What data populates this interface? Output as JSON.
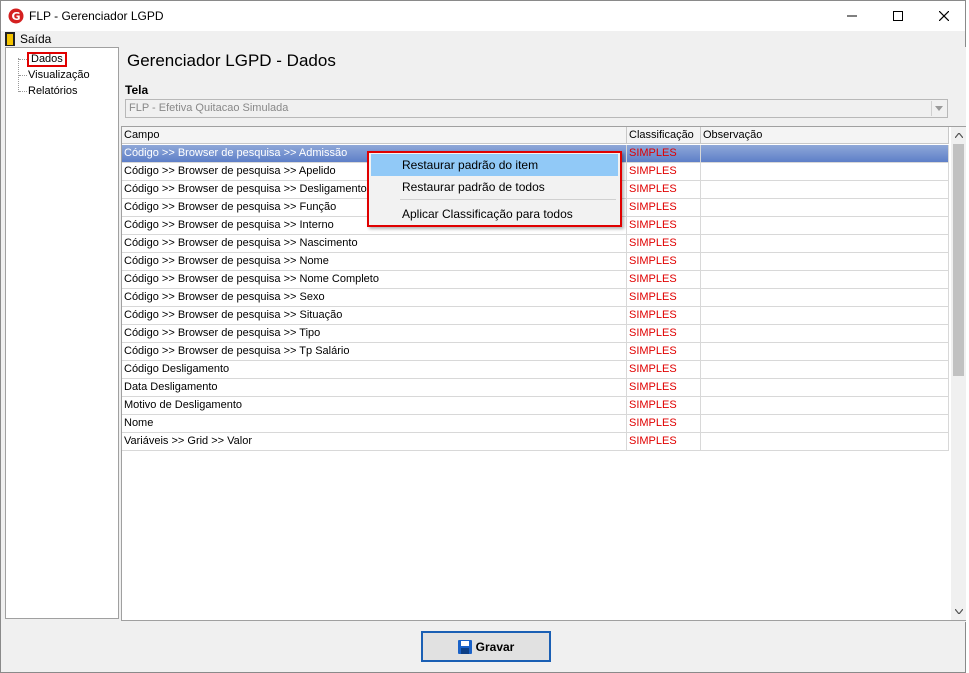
{
  "window": {
    "title": "FLP - Gerenciador LGPD"
  },
  "menu": {
    "exit_label": "Saída"
  },
  "tree": {
    "items": [
      "Dados",
      "Visualização",
      "Relatórios"
    ]
  },
  "page": {
    "title": "Gerenciador LGPD - Dados"
  },
  "tela": {
    "label": "Tela",
    "value": "FLP - Efetiva Quitacao Simulada"
  },
  "grid": {
    "columns": [
      "Campo",
      "Classificação",
      "Observação"
    ],
    "rows": [
      {
        "campo": "Código >> Browser de pesquisa >> Admissão",
        "classificacao": "SIMPLES",
        "observacao": ""
      },
      {
        "campo": "Código >> Browser de pesquisa >> Apelido",
        "classificacao": "SIMPLES",
        "observacao": ""
      },
      {
        "campo": "Código >> Browser de pesquisa >> Desligamento",
        "classificacao": "SIMPLES",
        "observacao": ""
      },
      {
        "campo": "Código >> Browser de pesquisa >> Função",
        "classificacao": "SIMPLES",
        "observacao": ""
      },
      {
        "campo": "Código >> Browser de pesquisa >> Interno",
        "classificacao": "SIMPLES",
        "observacao": ""
      },
      {
        "campo": "Código >> Browser de pesquisa >> Nascimento",
        "classificacao": "SIMPLES",
        "observacao": ""
      },
      {
        "campo": "Código >> Browser de pesquisa >> Nome",
        "classificacao": "SIMPLES",
        "observacao": ""
      },
      {
        "campo": "Código >> Browser de pesquisa >> Nome Completo",
        "classificacao": "SIMPLES",
        "observacao": ""
      },
      {
        "campo": "Código >> Browser de pesquisa >> Sexo",
        "classificacao": "SIMPLES",
        "observacao": ""
      },
      {
        "campo": "Código >> Browser de pesquisa >> Situação",
        "classificacao": "SIMPLES",
        "observacao": ""
      },
      {
        "campo": "Código >> Browser de pesquisa >> Tipo",
        "classificacao": "SIMPLES",
        "observacao": ""
      },
      {
        "campo": "Código >> Browser de pesquisa >> Tp Salário",
        "classificacao": "SIMPLES",
        "observacao": ""
      },
      {
        "campo": "Código Desligamento",
        "classificacao": "SIMPLES",
        "observacao": ""
      },
      {
        "campo": "Data Desligamento",
        "classificacao": "SIMPLES",
        "observacao": ""
      },
      {
        "campo": "Motivo de Desligamento",
        "classificacao": "SIMPLES",
        "observacao": ""
      },
      {
        "campo": "Nome",
        "classificacao": "SIMPLES",
        "observacao": ""
      },
      {
        "campo": "Variáveis >> Grid  >> Valor",
        "classificacao": "SIMPLES",
        "observacao": ""
      }
    ]
  },
  "context_menu": {
    "items": [
      "Restaurar padrão do item",
      "Restaurar padrão de todos",
      "Aplicar Classificação para todos"
    ]
  },
  "buttons": {
    "save_label": "Gravar"
  },
  "colors": {
    "accent": "#e00000",
    "selection": "#5e7fc8",
    "menu_hover": "#91c9f7"
  }
}
